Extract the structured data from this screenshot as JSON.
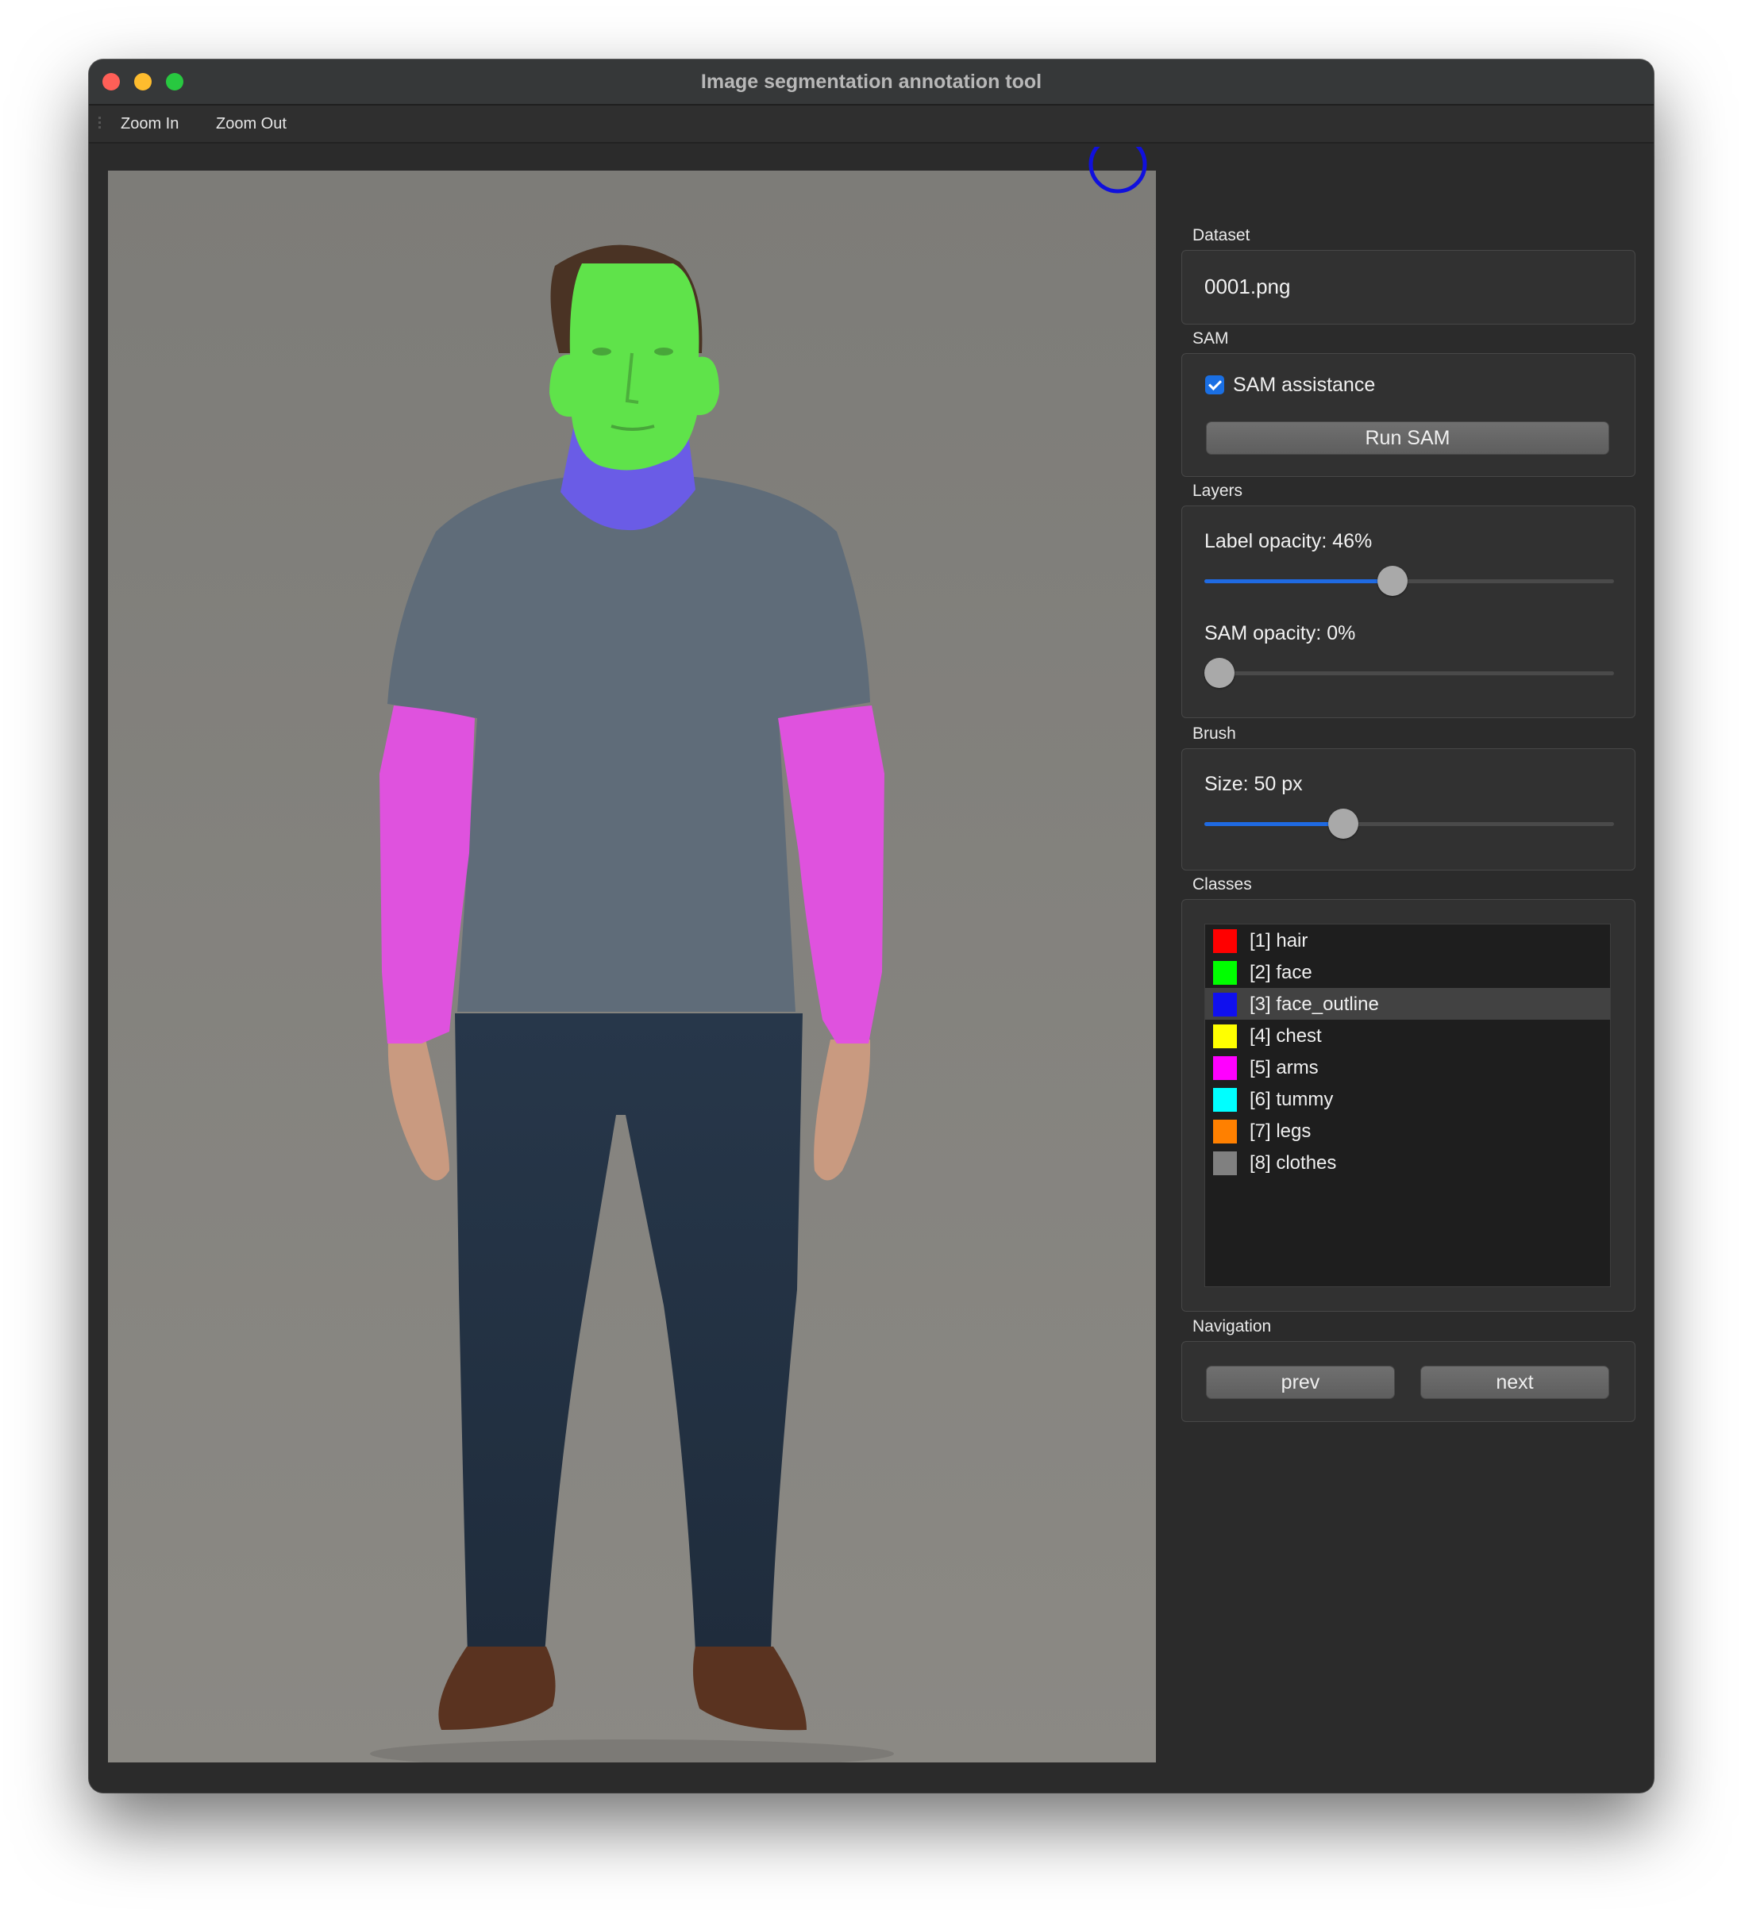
{
  "window": {
    "title": "Image segmentation annotation tool"
  },
  "menu": {
    "zoom_in": "Zoom In",
    "zoom_out": "Zoom Out"
  },
  "dataset": {
    "label": "Dataset",
    "file": "0001.png"
  },
  "sam": {
    "label": "SAM",
    "assistance_label": "SAM assistance",
    "assistance_checked": true,
    "run_button": "Run SAM"
  },
  "layers": {
    "label": "Layers",
    "label_opacity_text": "Label opacity: 46%",
    "label_opacity": 0.46,
    "sam_opacity_text": "SAM opacity: 0%",
    "sam_opacity": 0.0
  },
  "brush": {
    "label": "Brush",
    "size_text": "Size: 50 px",
    "size_fraction": 0.34
  },
  "classes": {
    "label": "Classes",
    "selected_index": 2,
    "items": [
      {
        "label": "[1] hair",
        "color": "#ff0000"
      },
      {
        "label": "[2] face",
        "color": "#00ff00"
      },
      {
        "label": "[3] face_outline",
        "color": "#1010ee"
      },
      {
        "label": "[4] chest",
        "color": "#ffff00"
      },
      {
        "label": "[5] arms",
        "color": "#ff00ff"
      },
      {
        "label": "[6] tummy",
        "color": "#00ffff"
      },
      {
        "label": "[7] legs",
        "color": "#ff8000"
      },
      {
        "label": "[8] clothes",
        "color": "#808080"
      }
    ]
  },
  "navigation": {
    "label": "Navigation",
    "prev": "prev",
    "next": "next"
  },
  "colors": {
    "overlay_face": "#5fe34a",
    "overlay_face_outline": "#6a5ce6",
    "overlay_arms": "#e44fe4",
    "accent": "#1f6ae2"
  }
}
